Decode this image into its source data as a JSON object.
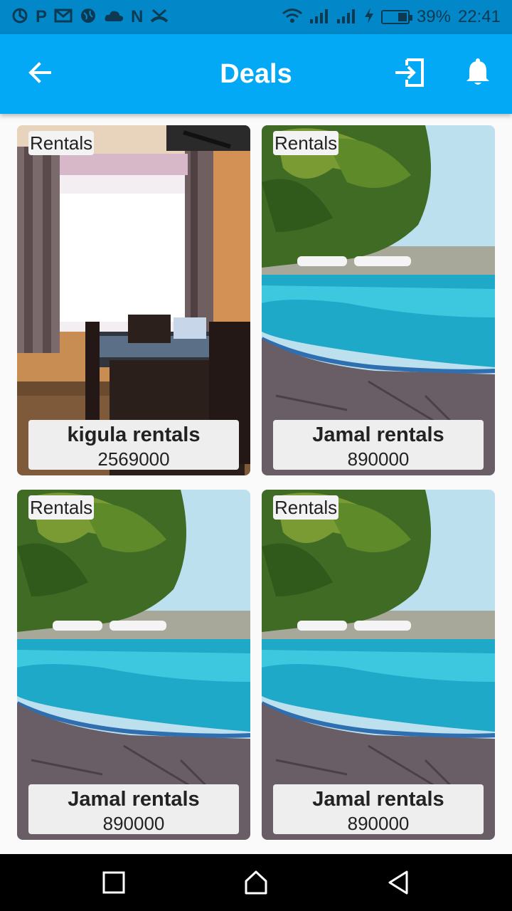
{
  "status_bar": {
    "battery": "39%",
    "time": "22:41",
    "battery_level": 0.39,
    "notification_icons": [
      "sync-icon",
      "p-icon",
      "gmail-icon",
      "globe-icon",
      "cloud-icon",
      "n-icon",
      "missed-call-icon"
    ]
  },
  "app_bar": {
    "title": "Deals",
    "color": "#03a9f4",
    "back_icon": "arrow-back-icon",
    "login_icon": "login-icon",
    "notification_icon": "bell-icon"
  },
  "deals": [
    {
      "tag": "Rentals",
      "name": "kigula rentals",
      "price": "2569000",
      "image": "dining-room"
    },
    {
      "tag": "Rentals",
      "name": "Jamal rentals",
      "price": "890000",
      "image": "pool"
    },
    {
      "tag": "Rentals",
      "name": "Jamal rentals",
      "price": "890000",
      "image": "pool"
    },
    {
      "tag": "Rentals",
      "name": "Jamal rentals",
      "price": "890000",
      "image": "pool"
    }
  ],
  "nav_bar": {
    "recents_icon": "square-icon",
    "home_icon": "home-icon",
    "back_icon": "triangle-back-icon"
  }
}
